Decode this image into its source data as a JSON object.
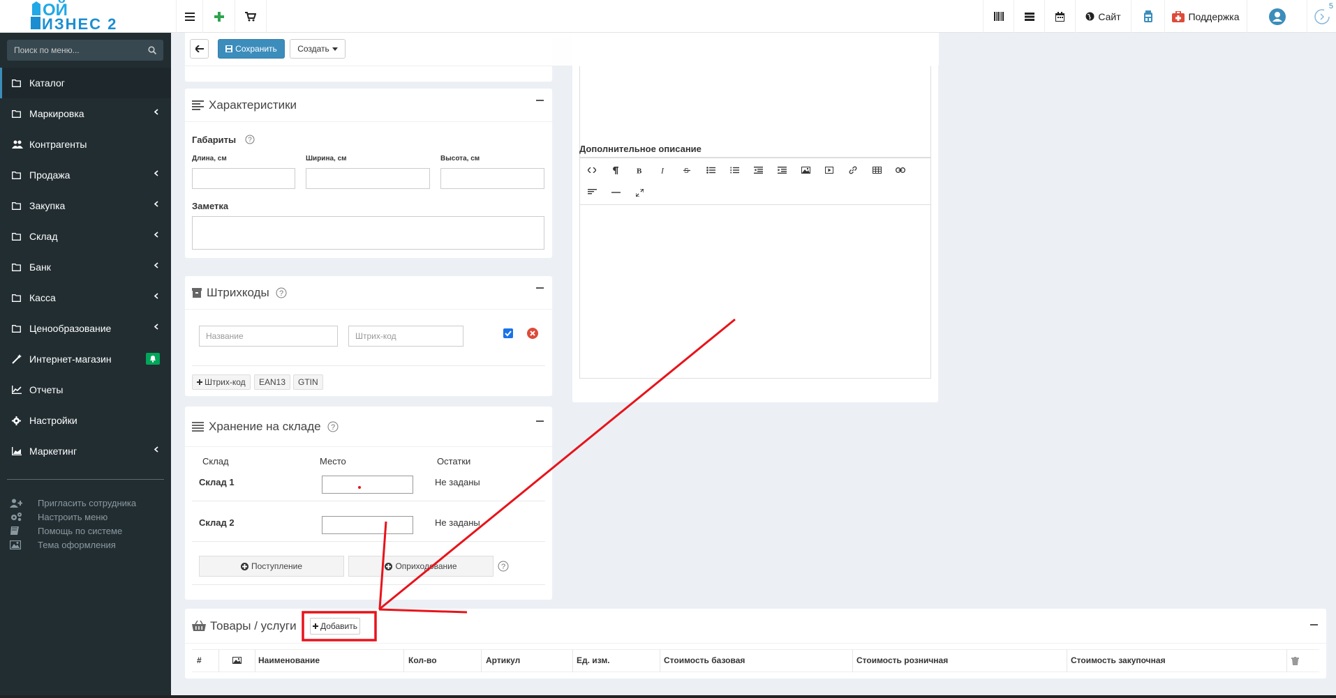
{
  "topbar": {
    "logo": {
      "line1": "ОЙ",
      "line2": "ИЗНЕС 2"
    },
    "site_label": "Сайт",
    "support_label": "Поддержка",
    "notif_count": "5"
  },
  "sidebar": {
    "search_placeholder": "Поиск по меню...",
    "items": [
      {
        "label": "Каталог",
        "icon": "folder-icon",
        "has_submenu": false,
        "active": true
      },
      {
        "label": "Маркировка",
        "icon": "folder-icon",
        "has_submenu": true
      },
      {
        "label": "Контрагенты",
        "icon": "users-icon",
        "has_submenu": false
      },
      {
        "label": "Продажа",
        "icon": "folder-icon",
        "has_submenu": true
      },
      {
        "label": "Закупка",
        "icon": "folder-icon",
        "has_submenu": true
      },
      {
        "label": "Склад",
        "icon": "folder-icon",
        "has_submenu": true
      },
      {
        "label": "Банк",
        "icon": "folder-icon",
        "has_submenu": true
      },
      {
        "label": "Касса",
        "icon": "folder-icon",
        "has_submenu": true
      },
      {
        "label": "Ценообразование",
        "icon": "folder-icon",
        "has_submenu": true
      },
      {
        "label": "Интернет-магазин",
        "icon": "magic-wand-icon",
        "has_submenu": false,
        "badge_icon": "bell-icon"
      },
      {
        "label": "Отчеты",
        "icon": "line-chart-icon",
        "has_submenu": false
      },
      {
        "label": "Настройки",
        "icon": "gear-icon",
        "has_submenu": false
      },
      {
        "label": "Маркетинг",
        "icon": "area-chart-icon",
        "has_submenu": true
      }
    ],
    "utility": [
      {
        "label": "Пригласить сотрудника",
        "icon": "user-plus-icon"
      },
      {
        "label": "Настроить меню",
        "icon": "cogs-icon"
      },
      {
        "label": "Помощь по системе",
        "icon": "book-icon"
      },
      {
        "label": "Тема оформления",
        "icon": "image-icon"
      }
    ]
  },
  "toolbar": {
    "save_label": "Сохранить",
    "create_label": "Создать"
  },
  "characteristics": {
    "title": "Характеристики",
    "dimensions_label": "Габариты",
    "length_label": "Длина, см",
    "width_label": "Ширина, см",
    "height_label": "Высота, см",
    "note_label": "Заметка"
  },
  "barcodes": {
    "title": "Штрихкоды",
    "name_placeholder": "Название",
    "code_placeholder": "Штрих-код",
    "add_barcode_label": "Штрих-код",
    "ean13_label": "EAN13",
    "gtin_label": "GTIN"
  },
  "storage": {
    "title": "Хранение на складе",
    "col_warehouse": "Склад",
    "col_place": "Место",
    "col_stock": "Остатки",
    "rows": [
      {
        "warehouse": "Склад 1",
        "stock": "Не заданы"
      },
      {
        "warehouse": "Склад 2",
        "stock": "Не заданы"
      }
    ],
    "receipt_label": "Поступление",
    "posting_label": "Оприходование"
  },
  "description": {
    "additional_label": "Дополнительное описание",
    "tools": [
      "code-icon",
      "paragraph-icon",
      "bold-icon",
      "italic-icon",
      "strikethrough-icon",
      "unordered-list-icon",
      "ordered-list-icon",
      "outdent-icon",
      "indent-icon",
      "image-icon",
      "video-icon",
      "link-icon",
      "table-icon",
      "unlink-icon",
      "align-icon",
      "horizontal-rule-icon",
      "fullscreen-icon"
    ]
  },
  "products": {
    "title": "Товары / услуги",
    "add_label": "Добавить",
    "columns": [
      "#",
      "Наименование",
      "Кол-во",
      "Артикул",
      "Ед. изм.",
      "Стоимость базовая",
      "Стоимость розничная",
      "Стоимость закупочная"
    ]
  },
  "colors": {
    "sidebar_bg": "#222d32",
    "accent": "#3c8dbc",
    "annotation": "#e8131a"
  }
}
